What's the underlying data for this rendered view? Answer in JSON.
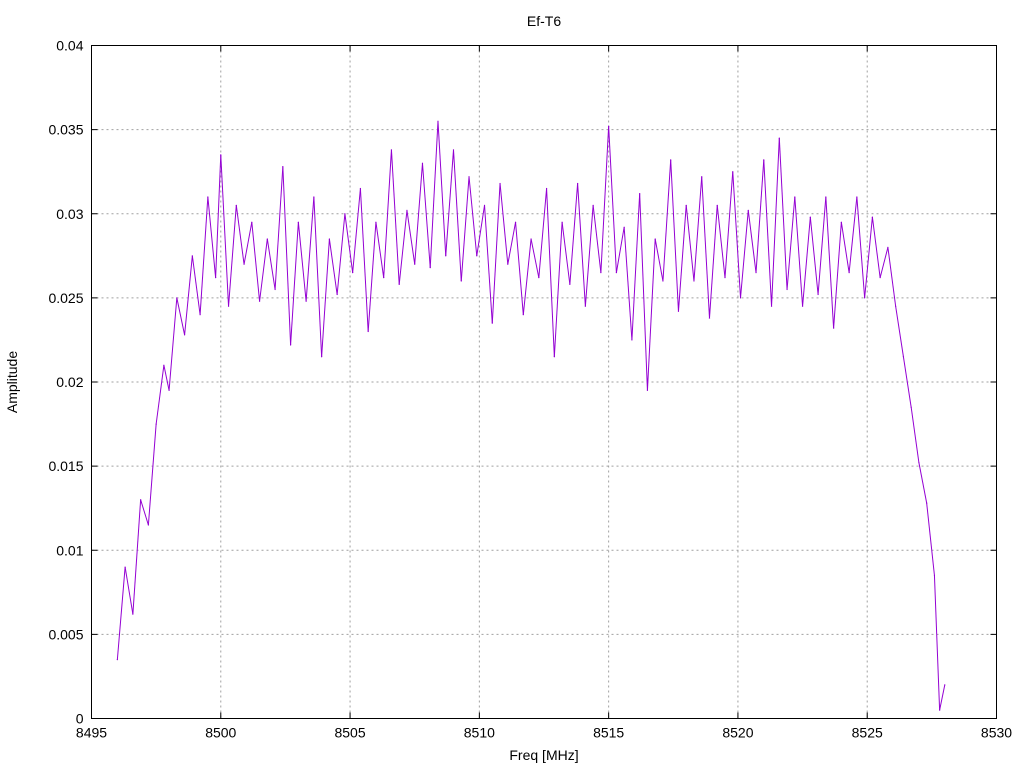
{
  "chart_data": {
    "type": "line",
    "title": "Ef-T6",
    "xlabel": "Freq [MHz]",
    "ylabel": "Amplitude",
    "xlim": [
      8495,
      8530
    ],
    "ylim": [
      0,
      0.04
    ],
    "grid": true,
    "x_ticks": [
      "8495",
      "8500",
      "8505",
      "8510",
      "8515",
      "8520",
      "8525",
      "8530"
    ],
    "y_ticks": [
      "0",
      "0.005",
      "0.01",
      "0.015",
      "0.02",
      "0.025",
      "0.03",
      "0.035",
      "0.04"
    ],
    "series": [
      {
        "color": "#9400d3",
        "x": [
          8496.0,
          8496.3,
          8496.6,
          8496.9,
          8497.2,
          8497.5,
          8497.8,
          8498.0,
          8498.3,
          8498.6,
          8498.9,
          8499.2,
          8499.5,
          8499.8,
          8500.0,
          8500.3,
          8500.6,
          8500.9,
          8501.2,
          8501.5,
          8501.8,
          8502.1,
          8502.4,
          8502.7,
          8503.0,
          8503.3,
          8503.6,
          8503.9,
          8504.2,
          8504.5,
          8504.8,
          8505.1,
          8505.4,
          8505.7,
          8506.0,
          8506.3,
          8506.6,
          8506.9,
          8507.2,
          8507.5,
          8507.8,
          8508.1,
          8508.4,
          8508.7,
          8509.0,
          8509.3,
          8509.6,
          8509.9,
          8510.2,
          8510.5,
          8510.8,
          8511.1,
          8511.4,
          8511.7,
          8512.0,
          8512.3,
          8512.6,
          8512.9,
          8513.2,
          8513.5,
          8513.8,
          8514.1,
          8514.4,
          8514.7,
          8515.0,
          8515.3,
          8515.6,
          8515.9,
          8516.2,
          8516.5,
          8516.8,
          8517.1,
          8517.4,
          8517.7,
          8518.0,
          8518.3,
          8518.6,
          8518.9,
          8519.2,
          8519.5,
          8519.8,
          8520.1,
          8520.4,
          8520.7,
          8521.0,
          8521.3,
          8521.6,
          8521.9,
          8522.2,
          8522.5,
          8522.8,
          8523.1,
          8523.4,
          8523.7,
          8524.0,
          8524.3,
          8524.6,
          8524.9,
          8525.2,
          8525.5,
          8525.8,
          8526.1,
          8526.4,
          8526.7,
          8527.0,
          8527.3,
          8527.6,
          8527.8,
          8528.0
        ],
        "y": [
          0.0035,
          0.009,
          0.0062,
          0.013,
          0.0115,
          0.0175,
          0.021,
          0.0195,
          0.025,
          0.0228,
          0.0275,
          0.024,
          0.031,
          0.0262,
          0.0335,
          0.0245,
          0.0305,
          0.027,
          0.0295,
          0.0248,
          0.0285,
          0.0255,
          0.0328,
          0.0222,
          0.0295,
          0.0248,
          0.031,
          0.0215,
          0.0285,
          0.0252,
          0.03,
          0.0265,
          0.0315,
          0.023,
          0.0295,
          0.0262,
          0.0338,
          0.0258,
          0.0302,
          0.027,
          0.033,
          0.0268,
          0.0355,
          0.0275,
          0.0338,
          0.026,
          0.0322,
          0.0275,
          0.0305,
          0.0235,
          0.0318,
          0.027,
          0.0295,
          0.024,
          0.0285,
          0.0262,
          0.0315,
          0.0215,
          0.0295,
          0.0258,
          0.0318,
          0.0245,
          0.0305,
          0.0265,
          0.0352,
          0.0265,
          0.0292,
          0.0225,
          0.0312,
          0.0195,
          0.0285,
          0.026,
          0.0332,
          0.0242,
          0.0305,
          0.026,
          0.0322,
          0.0238,
          0.0305,
          0.0262,
          0.0325,
          0.025,
          0.0302,
          0.0265,
          0.0332,
          0.0245,
          0.0345,
          0.0255,
          0.031,
          0.0245,
          0.0298,
          0.0252,
          0.031,
          0.0232,
          0.0295,
          0.0265,
          0.031,
          0.025,
          0.0298,
          0.0262,
          0.028,
          0.0245,
          0.0215,
          0.0185,
          0.0152,
          0.0128,
          0.0085,
          0.0005,
          0.002
        ]
      }
    ]
  }
}
